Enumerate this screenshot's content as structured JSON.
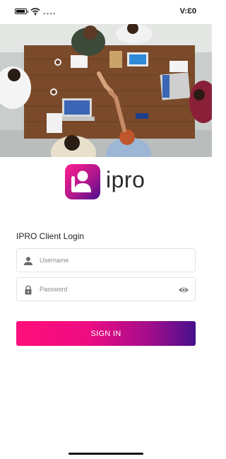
{
  "status_bar": {
    "time": "V:Ɛ0",
    "battery_icon": "battery-icon",
    "wifi_icon": "wifi-icon",
    "signal_icon": "signal-icon"
  },
  "hero": {
    "image": "team meeting around wooden table photo"
  },
  "logo": {
    "text": "ipro",
    "icon": "user-badge-icon"
  },
  "login": {
    "title": "IPRO Client Login",
    "username": {
      "placeholder": "Username",
      "value": "",
      "icon": "person-icon"
    },
    "password": {
      "placeholder": "Password",
      "value": "",
      "icon": "lock-icon",
      "toggle_icon": "eye-icon"
    },
    "sign_in_label": "SIGN IN"
  },
  "colors": {
    "gradient_start": "#ff0f7b",
    "gradient_end": "#46108c",
    "text": "#222222",
    "field_border": "#e3e3e3"
  }
}
